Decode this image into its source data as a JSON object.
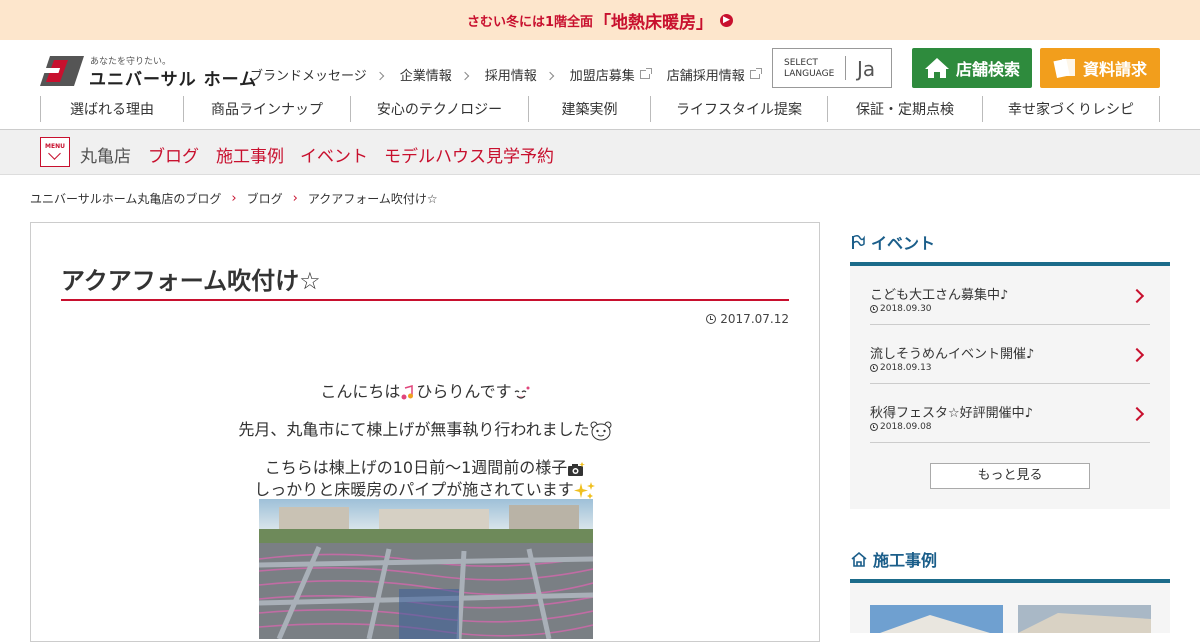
{
  "promo": {
    "part1": "さむい冬には1階全面",
    "part2": "「地熱床暖房」",
    "arrow_icon": "circle-chevron-right-icon"
  },
  "brand": {
    "tagline": "あなたを守りたい。",
    "name": "ユニバーサル ホーム",
    "mark_colors": [
      "#c8102e",
      "#555555"
    ]
  },
  "utility_nav": [
    {
      "label": "ブランドメッセージ",
      "icon": "chevron-right-icon"
    },
    {
      "label": "企業情報",
      "icon": "chevron-right-icon"
    },
    {
      "label": "採用情報",
      "icon": "chevron-right-icon"
    },
    {
      "label": "加盟店募集",
      "icon": "external-link-icon"
    },
    {
      "label": "店舗採用情報",
      "icon": "external-link-icon"
    }
  ],
  "language": {
    "label_line1": "SELECT",
    "label_line2": "LANGUAGE",
    "value": "Ja"
  },
  "buttons": {
    "store_search": "店舗検索",
    "request_docs": "資料請求",
    "store_color": "#2e8b3d",
    "request_color": "#f29e1c"
  },
  "main_nav": [
    "選ばれる理由",
    "商品ラインナップ",
    "安心のテクノロジー",
    "建築実例",
    "ライフスタイル提案",
    "保証・定期点検",
    "幸せ家づくりレシピ"
  ],
  "subbar": {
    "menu_label": "MENU",
    "store_name": "丸亀店",
    "links": [
      "ブログ",
      "施工事例",
      "イベント",
      "モデルハウス見学予約"
    ]
  },
  "breadcrumb": [
    "ユニバーサルホーム丸亀店のブログ",
    "ブログ",
    "アクアフォーム吹付け☆"
  ],
  "article": {
    "title": "アクアフォーム吹付け☆",
    "date": "2017.07.12",
    "lines": [
      "こんにちは",
      "ひらりんです",
      "先月、丸亀市にて棟上げが無事執り行われました",
      "こちらは棟上げの10日前～1週間前の様子",
      "しっかりと床暖房のパイプが施されています"
    ],
    "accent_color": "#c8102e"
  },
  "sidebar": {
    "events_heading": "イベント",
    "events": [
      {
        "title": "こども大工さん募集中♪",
        "date": "2018.09.30"
      },
      {
        "title": "流しそうめんイベント開催♪",
        "date": "2018.09.13"
      },
      {
        "title": "秋得フェスタ☆好評開催中♪",
        "date": "2018.09.08"
      }
    ],
    "more_label": "もっと見る",
    "works_heading": "施工事例",
    "heading_color": "#1b5e8a"
  }
}
